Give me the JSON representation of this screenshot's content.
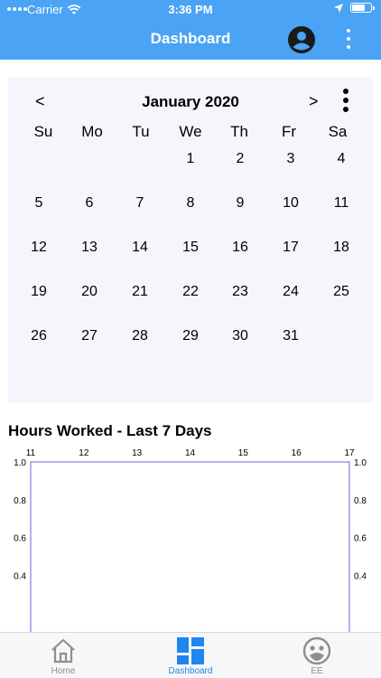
{
  "status_bar": {
    "carrier": "Carrier",
    "time": "3:36 PM"
  },
  "header": {
    "title": "Dashboard",
    "color": "#4aa3f4"
  },
  "calendar": {
    "prev": "<",
    "month": "January 2020",
    "next": ">",
    "weekdays": [
      "Su",
      "Mo",
      "Tu",
      "We",
      "Th",
      "Fr",
      "Sa"
    ],
    "weeks": [
      [
        "",
        "",
        "",
        "1",
        "2",
        "3",
        "4"
      ],
      [
        "5",
        "6",
        "7",
        "8",
        "9",
        "10",
        "11"
      ],
      [
        "12",
        "13",
        "14",
        "15",
        "16",
        "17",
        "18"
      ],
      [
        "19",
        "20",
        "21",
        "22",
        "23",
        "24",
        "25"
      ],
      [
        "26",
        "27",
        "28",
        "29",
        "30",
        "31",
        ""
      ]
    ]
  },
  "chart_section": {
    "title": "Hours Worked - Last 7 Days"
  },
  "chart_data": {
    "type": "line",
    "title": "Hours Worked - Last 7 Days",
    "x_ticks": [
      "11",
      "12",
      "13",
      "14",
      "15",
      "16",
      "17"
    ],
    "y_ticks_left": [
      "1.0",
      "0.8",
      "0.6",
      "0.4"
    ],
    "y_ticks_right": [
      "1.0",
      "0.8",
      "0.6",
      "0.4"
    ],
    "xlim": [
      11,
      17
    ],
    "ylim": [
      0,
      1.0
    ],
    "series": [],
    "frame_color": "#6c63d9"
  },
  "tabbar": {
    "tabs": [
      {
        "label": "Home",
        "icon": "house-icon",
        "active": false
      },
      {
        "label": "Dashboard",
        "icon": "dashboard-grid-icon",
        "active": true
      },
      {
        "label": "EE",
        "icon": "face-icon",
        "active": false
      }
    ],
    "active_color": "#1f86f0",
    "inactive_color": "#8e8e93"
  }
}
